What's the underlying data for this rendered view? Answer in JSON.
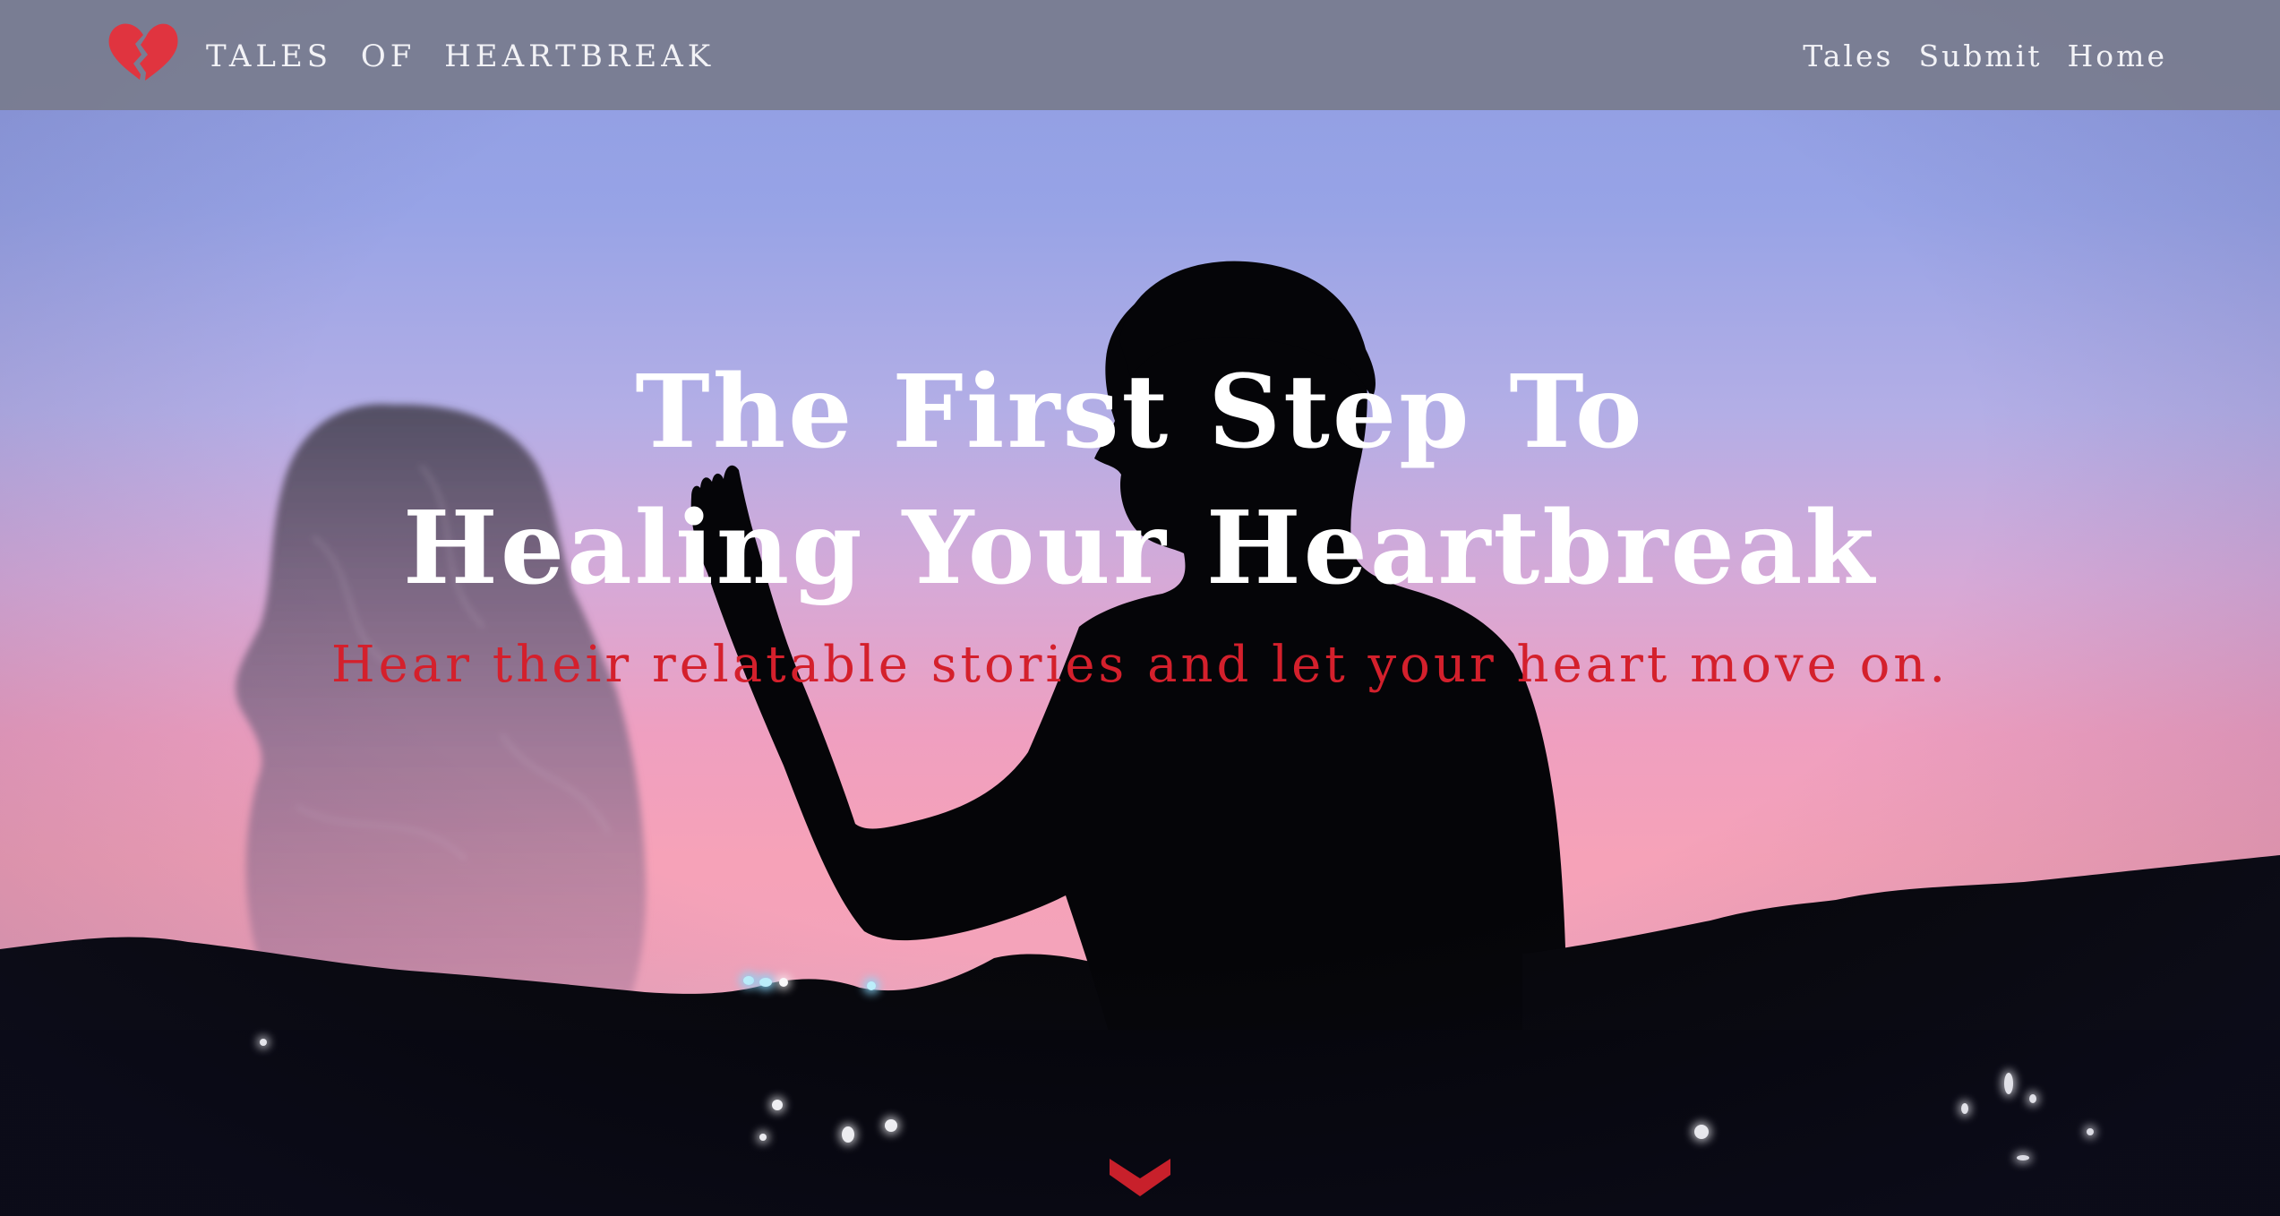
{
  "brand": {
    "name": "TALES OF HEARTBREAK",
    "logo_icon": "broken-heart-icon",
    "logo_color": "#e0343f"
  },
  "nav": {
    "items": [
      {
        "label": "Tales"
      },
      {
        "label": "Submit"
      },
      {
        "label": "Home"
      }
    ]
  },
  "hero": {
    "headline_line1": "The First Step To",
    "headline_line2": "Healing Your Heartbreak",
    "subtitle": "Hear their relatable stories and let your heart move on.",
    "subtitle_color": "#d4202c",
    "scroll_icon": "chevron-down-icon",
    "scroll_icon_color": "#c8202b"
  },
  "theme": {
    "navbar_color": "#7f8397",
    "text_color": "#ffffff",
    "sky_top_color": "#8f9de2",
    "sky_bottom_color": "#f4a3ba",
    "silhouette_color": "#050508"
  }
}
